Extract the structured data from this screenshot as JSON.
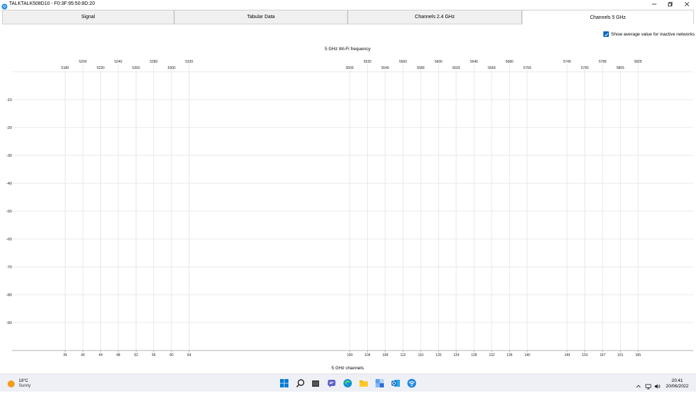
{
  "window": {
    "title": "TALKTALK508D10 - F0:3F:95:50:8D:20"
  },
  "tabs": [
    {
      "label": "Signal",
      "active": false
    },
    {
      "label": "Tabular Data",
      "active": false
    },
    {
      "label": "Channels 2.4 GHz",
      "active": false
    },
    {
      "label": "Channels 5 GHz",
      "active": true
    }
  ],
  "options": {
    "show_average_label": "Show average value for inactive networks",
    "show_average_checked": true
  },
  "chart_data": {
    "type": "line",
    "title": "5 GHz Wi-Fi frequency",
    "xlabel": "5 GHz channels",
    "ylabel": "",
    "y_ticks": [
      -10,
      -20,
      -30,
      -40,
      -50,
      -60,
      -70,
      -80,
      -90
    ],
    "ylim": [
      -100,
      0
    ],
    "grid": true,
    "channels": [
      {
        "channel": "36",
        "freq": "5180",
        "row": "lower"
      },
      {
        "channel": "40",
        "freq": "5200",
        "row": "upper"
      },
      {
        "channel": "44",
        "freq": "5220",
        "row": "lower"
      },
      {
        "channel": "48",
        "freq": "5240",
        "row": "upper"
      },
      {
        "channel": "52",
        "freq": "5260",
        "row": "lower"
      },
      {
        "channel": "56",
        "freq": "5280",
        "row": "upper"
      },
      {
        "channel": "60",
        "freq": "5300",
        "row": "lower"
      },
      {
        "channel": "64",
        "freq": "5320",
        "row": "upper"
      },
      {
        "channel": "100",
        "freq": "5500",
        "row": "lower"
      },
      {
        "channel": "104",
        "freq": "5520",
        "row": "upper"
      },
      {
        "channel": "108",
        "freq": "5540",
        "row": "lower"
      },
      {
        "channel": "112",
        "freq": "5560",
        "row": "upper"
      },
      {
        "channel": "116",
        "freq": "5580",
        "row": "lower"
      },
      {
        "channel": "120",
        "freq": "5600",
        "row": "upper"
      },
      {
        "channel": "124",
        "freq": "5620",
        "row": "lower"
      },
      {
        "channel": "128",
        "freq": "5640",
        "row": "upper"
      },
      {
        "channel": "132",
        "freq": "5660",
        "row": "lower"
      },
      {
        "channel": "136",
        "freq": "5680",
        "row": "upper"
      },
      {
        "channel": "140",
        "freq": "5700",
        "row": "lower"
      },
      {
        "channel": "149",
        "freq": "5745",
        "row": "upper"
      },
      {
        "channel": "153",
        "freq": "5765",
        "row": "lower"
      },
      {
        "channel": "157",
        "freq": "5785",
        "row": "upper"
      },
      {
        "channel": "161",
        "freq": "5805",
        "row": "lower"
      },
      {
        "channel": "165",
        "freq": "5825",
        "row": "upper"
      }
    ],
    "series": []
  },
  "taskbar": {
    "weather": {
      "temp": "18°C",
      "condition": "Sunny",
      "icon": "sun-icon"
    },
    "apps": [
      "start-icon",
      "search-icon",
      "file-explorer-icon",
      "teams-chat-icon",
      "edge-browser-icon",
      "folder-icon",
      "snipping-tool-icon",
      "outlook-icon",
      "wifi-analyzer-app-icon"
    ],
    "time": "20:41",
    "date": "20/06/2022"
  },
  "colors": {
    "accent": "#0067c0",
    "grid": "#e3e3e3",
    "axis": "#999999",
    "tab_inactive": "#f0f0f0"
  }
}
